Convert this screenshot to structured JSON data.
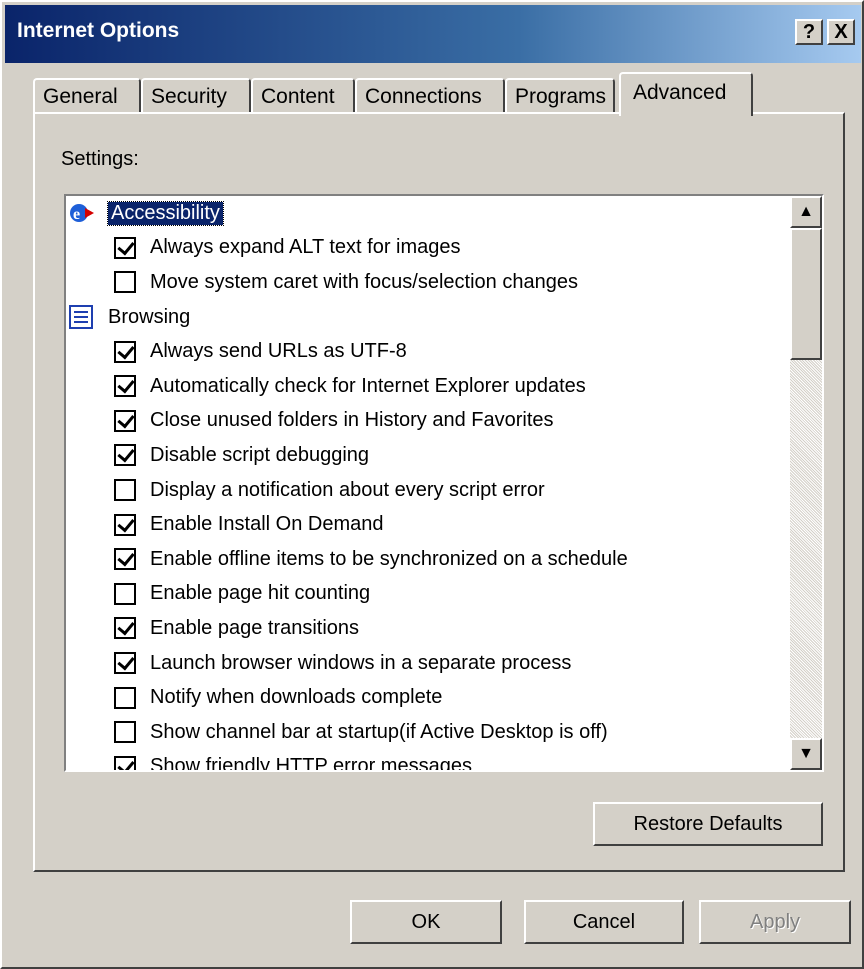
{
  "window": {
    "title": "Internet Options",
    "help_glyph": "?",
    "close_glyph": "X"
  },
  "tabs": [
    {
      "label": "General"
    },
    {
      "label": "Security"
    },
    {
      "label": "Content"
    },
    {
      "label": "Connections"
    },
    {
      "label": "Programs"
    },
    {
      "label": "Advanced",
      "active": true
    }
  ],
  "settings": {
    "label": "Settings:",
    "groups": [
      {
        "name": "Accessibility",
        "icon": "accessibility-icon",
        "selected": true,
        "items": [
          {
            "label": "Always expand ALT text for images",
            "checked": true
          },
          {
            "label": "Move system caret with focus/selection changes",
            "checked": false
          }
        ]
      },
      {
        "name": "Browsing",
        "icon": "browsing-icon",
        "selected": false,
        "items": [
          {
            "label": "Always send URLs as UTF-8",
            "checked": true
          },
          {
            "label": "Automatically check for Internet Explorer updates",
            "checked": true
          },
          {
            "label": "Close unused folders in History and Favorites",
            "checked": true
          },
          {
            "label": "Disable script debugging",
            "checked": true
          },
          {
            "label": "Display a notification about every script error",
            "checked": false
          },
          {
            "label": "Enable Install On Demand",
            "checked": true
          },
          {
            "label": "Enable offline items to be synchronized on a schedule",
            "checked": true
          },
          {
            "label": "Enable page hit counting",
            "checked": false
          },
          {
            "label": "Enable page transitions",
            "checked": true
          },
          {
            "label": "Launch browser windows in a separate process",
            "checked": true
          },
          {
            "label": "Notify when downloads complete",
            "checked": false
          },
          {
            "label": "Show channel bar at startup(if Active Desktop is off)",
            "checked": false
          },
          {
            "label": "Show friendly HTTP error messages",
            "checked": true
          }
        ]
      }
    ]
  },
  "buttons": {
    "restore": "Restore Defaults",
    "ok": "OK",
    "cancel": "Cancel",
    "apply": "Apply"
  }
}
